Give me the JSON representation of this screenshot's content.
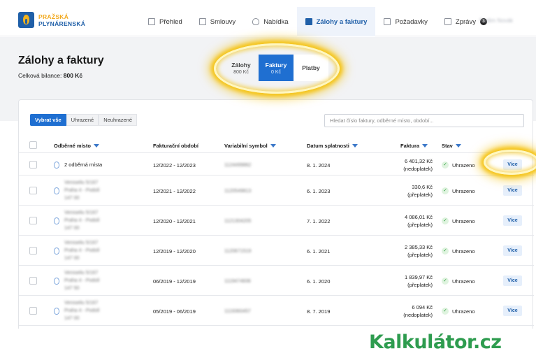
{
  "brand": {
    "line1": "PRAŽSKÁ",
    "line2": "PLYNÁRENSKÁ"
  },
  "nav": {
    "items": [
      {
        "label": "Přehled",
        "icon": "grid-icon"
      },
      {
        "label": "Smlouvy",
        "icon": "document-icon"
      },
      {
        "label": "Nabídka",
        "icon": "flame-icon"
      },
      {
        "label": "Zálohy a faktury",
        "icon": "invoice-icon"
      },
      {
        "label": "Požadavky",
        "icon": "request-icon"
      },
      {
        "label": "Zprávy",
        "icon": "message-icon",
        "badge": "3"
      }
    ],
    "user": "Radim Novák"
  },
  "page": {
    "title": "Zálohy a faktury",
    "balance_label": "Celková bilance:",
    "balance_value": "800 Kč"
  },
  "tabs": [
    {
      "label": "Zálohy",
      "sub": "800 Kč"
    },
    {
      "label": "Faktury",
      "sub": "0 Kč"
    },
    {
      "label": "Platby",
      "sub": ""
    }
  ],
  "filters": [
    "Vybrat vše",
    "Uhrazené",
    "Neuhrazené"
  ],
  "search": {
    "placeholder": "Hledat číslo faktury, odběrné místo, období..."
  },
  "columns": {
    "place": "Odběrné místo",
    "period": "Fakturační období",
    "vs": "Variabilní symbol",
    "due": "Datum splatnosti",
    "invoice": "Faktura",
    "status": "Stav"
  },
  "rows": [
    {
      "place": "2 odběrná místa",
      "place_blur": false,
      "period": "12/2022 - 12/2023",
      "vs": "1124499862",
      "due": "8. 1. 2024",
      "amount": "6 401,32 Kč",
      "note": "(nedoplatek)",
      "status": "Uhrazeno",
      "action": "Více"
    },
    {
      "place": "Verosellu 5/167 Praha 4 - Podolí 147 00",
      "place_blur": true,
      "period": "12/2021 - 12/2022",
      "vs": "1120549813",
      "due": "6. 1. 2023",
      "amount": "330,6 Kč",
      "note": "(přeplatek)",
      "status": "Uhrazeno",
      "action": "Více"
    },
    {
      "place": "Verosellu 5/167 Praha 4 - Podolí 147 00",
      "place_blur": true,
      "period": "12/2020 - 12/2021",
      "vs": "1121304205",
      "due": "7. 1. 2022",
      "amount": "4 086,01 Kč",
      "note": "(přeplatek)",
      "status": "Uhrazeno",
      "action": "Více"
    },
    {
      "place": "Verosellu 5/167 Praha 4 - Podolí 147 00",
      "place_blur": true,
      "period": "12/2019 - 12/2020",
      "vs": "1120671519",
      "due": "6. 1. 2021",
      "amount": "2 385,33 Kč",
      "note": "(přeplatek)",
      "status": "Uhrazeno",
      "action": "Více"
    },
    {
      "place": "Verosellu 5/167 Praha 4 - Podolí 147 50",
      "place_blur": true,
      "period": "06/2019 - 12/2019",
      "vs": "1119474836",
      "due": "6. 1. 2020",
      "amount": "1 839,97 Kč",
      "note": "(přeplatek)",
      "status": "Uhrazeno",
      "action": "Více"
    },
    {
      "place": "Verosellu 5/167 Praha 4 - Podolí 147 00",
      "place_blur": true,
      "period": "05/2019 - 06/2019",
      "vs": "1119360457",
      "due": "8. 7. 2019",
      "amount": "6 094 Kč",
      "note": "(nedoplatek)",
      "status": "Uhrazeno",
      "action": "Více"
    }
  ],
  "watermark": "Kalkulátor.cz",
  "colors": {
    "primary": "#1f6fd1",
    "brand_blue": "#1f5fa8",
    "brand_yellow": "#f2a91e",
    "watermark_green": "#2e9c4f",
    "highlight": "#f5c418"
  }
}
